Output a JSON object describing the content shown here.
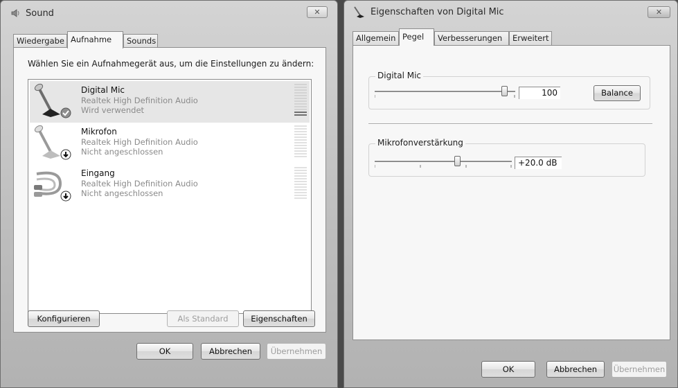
{
  "sound_window": {
    "title": "Sound",
    "close_label": "✕",
    "tabs": [
      {
        "label": "Wiedergabe",
        "active": false
      },
      {
        "label": "Aufnahme",
        "active": true
      },
      {
        "label": "Sounds",
        "active": false
      }
    ],
    "instruction": "Wählen Sie ein Aufnahmegerät aus, um die Einstellungen zu ändern:",
    "devices": [
      {
        "name": "Digital Mic",
        "driver": "Realtek High Definition Audio",
        "status": "Wird verwendet",
        "icon": "microphone-icon",
        "badge": "check-badge-icon",
        "selected": true
      },
      {
        "name": "Mikrofon",
        "driver": "Realtek High Definition Audio",
        "status": "Nicht angeschlossen",
        "icon": "microphone-icon",
        "badge": "unplugged-badge-icon",
        "selected": false
      },
      {
        "name": "Eingang",
        "driver": "Realtek High Definition Audio",
        "status": "Nicht angeschlossen",
        "icon": "line-in-cable-icon",
        "badge": "unplugged-badge-icon",
        "selected": false
      }
    ],
    "buttons": {
      "configure": "Konfigurieren",
      "set_default": "Als Standard",
      "properties": "Eigenschaften",
      "ok": "OK",
      "cancel": "Abbrechen",
      "apply": "Übernehmen"
    }
  },
  "props_window": {
    "title": "Eigenschaften von Digital Mic",
    "close_label": "✕",
    "tabs": [
      {
        "label": "Allgemein",
        "active": false
      },
      {
        "label": "Pegel",
        "active": true
      },
      {
        "label": "Verbesserungen",
        "active": false
      },
      {
        "label": "Erweitert",
        "active": false
      }
    ],
    "level_group": {
      "label": "Digital Mic",
      "value": "100",
      "slider_fraction": 1.0,
      "balance_button": "Balance"
    },
    "boost_group": {
      "label": "Mikrofonverstärkung",
      "value": "+20.0 dB",
      "slider_fraction": 0.6
    },
    "buttons": {
      "ok": "OK",
      "cancel": "Abbrechen",
      "apply": "Übernehmen"
    }
  }
}
